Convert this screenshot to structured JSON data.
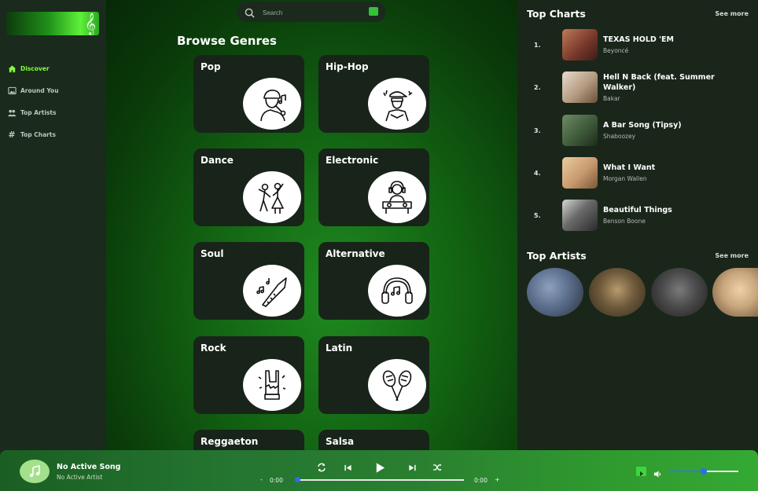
{
  "app": {
    "accent_color": "#7fff3a",
    "logo_icon": "treble-clef-note"
  },
  "sidebar": {
    "items": [
      {
        "label": "Discover",
        "icon": "home-icon",
        "active": true
      },
      {
        "label": "Around You",
        "icon": "image-icon",
        "active": false
      },
      {
        "label": "Top Artists",
        "icon": "users-icon",
        "active": false
      },
      {
        "label": "Top Charts",
        "icon": "hashtag-icon",
        "active": false
      }
    ]
  },
  "search": {
    "placeholder": "Search",
    "value": ""
  },
  "browse": {
    "title": "Browse Genres",
    "genres": [
      {
        "label": "Pop",
        "icon": "singer-icon"
      },
      {
        "label": "Hip-Hop",
        "icon": "rapper-icon"
      },
      {
        "label": "Dance",
        "icon": "dancers-icon"
      },
      {
        "label": "Electronic",
        "icon": "dj-icon"
      },
      {
        "label": "Soul",
        "icon": "saxophone-icon"
      },
      {
        "label": "Alternative",
        "icon": "headphones-icon"
      },
      {
        "label": "Rock",
        "icon": "rock-hand-icon"
      },
      {
        "label": "Latin",
        "icon": "maracas-icon"
      },
      {
        "label": "Reggaeton",
        "icon": ""
      },
      {
        "label": "Salsa",
        "icon": ""
      }
    ]
  },
  "top_charts": {
    "title": "Top Charts",
    "see_more": "See more",
    "songs": [
      {
        "rank": "1.",
        "title": "TEXAS HOLD 'EM",
        "artist": "Beyoncé",
        "thumb_color": "#7a3a2c"
      },
      {
        "rank": "2.",
        "title": "Hell N Back (feat. Summer Walker)",
        "artist": "Bakar",
        "thumb_color": "#c9b6a1"
      },
      {
        "rank": "3.",
        "title": "A Bar Song (Tipsy)",
        "artist": "Shaboozey",
        "thumb_color": "#3e5a3a"
      },
      {
        "rank": "4.",
        "title": "What I Want",
        "artist": "Morgan Wallen",
        "thumb_color": "#c79a6e"
      },
      {
        "rank": "5.",
        "title": "Beautiful Things",
        "artist": "Benson Boone",
        "thumb_color": "#3a3a3a"
      }
    ]
  },
  "top_artists": {
    "title": "Top Artists",
    "see_more": "See more",
    "artists": [
      {
        "color": "#5a6e8c"
      },
      {
        "color": "#6f5a3c"
      },
      {
        "color": "#4a4a4a"
      },
      {
        "color": "#c8a67e"
      }
    ]
  },
  "player": {
    "song_title": "No Active Song",
    "song_artist": "No Active Artist",
    "current_time": "0:00",
    "duration": "0:00",
    "minus": "-",
    "plus": "+",
    "progress": 0,
    "volume": 0.5
  }
}
